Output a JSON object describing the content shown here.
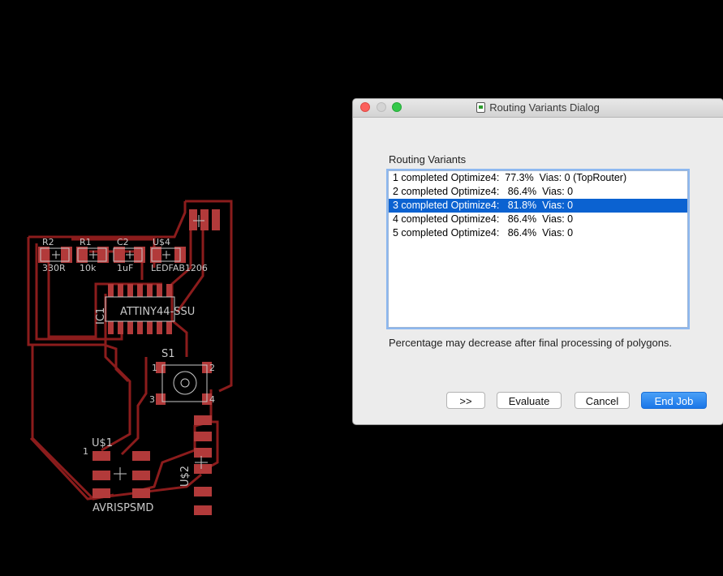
{
  "board": {
    "refdes": {
      "r2": "R2",
      "r1": "R1",
      "c2": "C2",
      "u4": "U$4",
      "ic1": "IC1",
      "s1": "S1",
      "u1": "U$1",
      "u2": "U$2"
    },
    "values": {
      "r2": "330R",
      "r1": "10k",
      "c2": "1uF",
      "u4": "LEDFAB1206",
      "ic1": "ATTINY44-SSU",
      "u1": "AVRISPSMD"
    },
    "pins": {
      "s1_1": "1",
      "s1_2": "2",
      "s1_3": "3",
      "s1_4": "4",
      "u1_1": "1"
    },
    "colors": {
      "trace": "#8b1c1c",
      "pad": "#b23a3a",
      "silk": "#c8c8c8"
    }
  },
  "dialog": {
    "title": "Routing Variants Dialog",
    "list_label": "Routing Variants",
    "variants": [
      "1 completed Optimize4:  77.3%  Vias: 0 (TopRouter)",
      "2 completed Optimize4:   86.4%  Vias: 0",
      "3 completed Optimize4:   81.8%  Vias: 0",
      "4 completed Optimize4:   86.4%  Vias: 0",
      "5 completed Optimize4:   86.4%  Vias: 0"
    ],
    "selected_index": 2,
    "note": "Percentage may decrease after final processing of polygons.",
    "buttons": {
      "more": ">>",
      "evaluate": "Evaluate",
      "cancel": "Cancel",
      "end_job": "End Job"
    },
    "colors": {
      "selection": "#0b62d1",
      "default_button": "#1a76e8"
    }
  }
}
